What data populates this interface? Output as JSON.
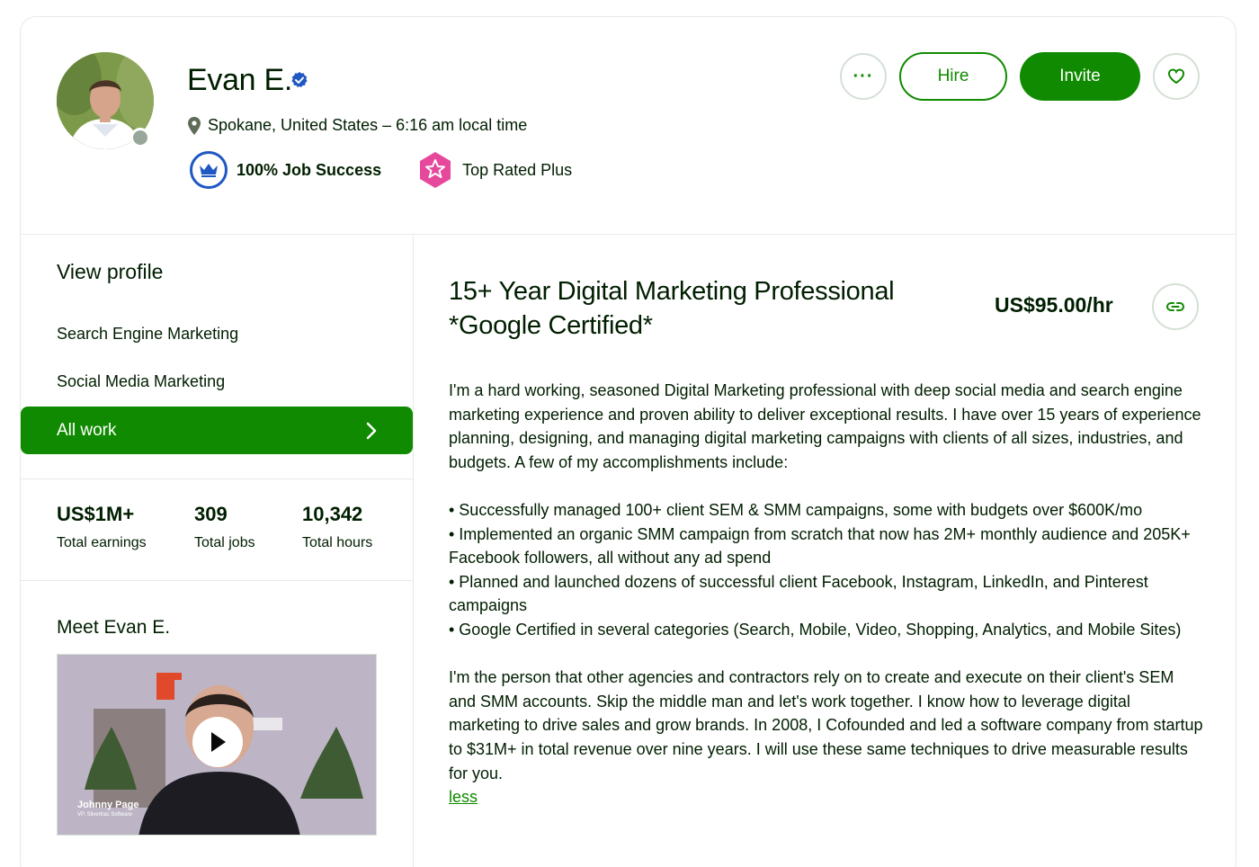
{
  "profile": {
    "name": "Evan E.",
    "location": "Spokane, United States – 6:16 am local time",
    "job_success": "100% Job Success",
    "top_rated": "Top Rated Plus"
  },
  "actions": {
    "more_label": "···",
    "hire_label": "Hire",
    "invite_label": "Invite"
  },
  "sidebar": {
    "view_profile": "View profile",
    "items": [
      {
        "label": "Search Engine Marketing"
      },
      {
        "label": "Social Media Marketing"
      },
      {
        "label": "All work"
      }
    ],
    "stats": [
      {
        "value": "US$1M+",
        "label": "Total earnings"
      },
      {
        "value": "309",
        "label": "Total jobs"
      },
      {
        "value": "10,342",
        "label": "Total hours"
      }
    ],
    "meet_title": "Meet Evan E.",
    "video": {
      "caption_name": "Johnny Page",
      "caption_role": "VP, Silvertrac Software"
    }
  },
  "main": {
    "title": "15+ Year Digital Marketing Professional *Google Certified*",
    "rate": "US$95.00/hr",
    "paragraphs": [
      "I'm a hard working, seasoned Digital Marketing professional with deep social media and search engine marketing experience and proven ability to deliver exceptional results. I have over 15 years of experience planning, designing, and managing digital marketing campaigns with clients of all sizes, industries, and budgets. A few of my accomplishments include:",
      "• Successfully managed 100+ client SEM & SMM campaigns, some with budgets over $600K/mo",
      "• Implemented an organic SMM campaign from scratch that now has 2M+ monthly audience and 205K+ Facebook followers, all without any ad spend",
      "• Planned and launched dozens of successful client Facebook, Instagram, LinkedIn, and Pinterest campaigns",
      "• Google Certified in several categories (Search, Mobile, Video, Shopping, Analytics, and Mobile Sites)",
      "I'm the person that other agencies and contractors rely on to create and execute on their client's SEM and SMM accounts. Skip the middle man and let's work together. I know how to leverage digital marketing to drive sales and grow brands. In 2008, I Cofounded and led a software company from startup to $31M+ in total revenue over nine years. I will use these same techniques to drive measurable results for you."
    ],
    "less_label": "less"
  },
  "colors": {
    "brand_green": "#108a00",
    "text_dark": "#001e00",
    "verified_blue": "#1f57c3",
    "top_rated_pink": "#e6489b"
  }
}
